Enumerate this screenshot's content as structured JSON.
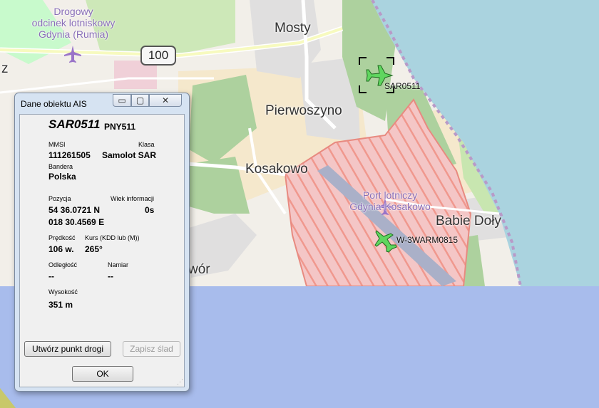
{
  "map": {
    "towns": [
      {
        "id": "mosty",
        "text": "Mosty"
      },
      {
        "id": "pierwoszyno",
        "text": "Pierwoszyno"
      },
      {
        "id": "kosakowo",
        "text": "Kosakowo"
      },
      {
        "id": "babie-doly",
        "text": "Babie Doły"
      },
      {
        "id": "partial-wor",
        "text": "wór"
      },
      {
        "id": "partial-z",
        "text": "z"
      }
    ],
    "airport_labels": [
      {
        "id": "drogowy",
        "lines": [
          "Drogowy",
          "odcinek lotniskowy",
          "Gdynia (Rumia)"
        ]
      },
      {
        "id": "kosakowo-airport",
        "lines": [
          "Port lotniczy",
          "Gdynia-Kosakowo"
        ]
      }
    ],
    "road_number": "100",
    "aircraft": [
      {
        "id": "sar0511",
        "label": "SAR0511",
        "selected": true
      },
      {
        "id": "w3warm0815",
        "label": "W-3WARM0815",
        "selected": false
      }
    ],
    "colors": {
      "sea": "#aad3df",
      "forest": "#add19e",
      "residential": "#e0dfdf",
      "airport_area": "#f4c6c6",
      "aircraft": "#5fd65f",
      "lower_area": "#a8bcec"
    }
  },
  "dialog": {
    "title": "Dane obiektu AIS",
    "controls": {
      "min": "▭",
      "max": "▢",
      "close": "✕"
    },
    "vessel_name": "SAR0511",
    "callsign": "PNY511",
    "fields": {
      "mmsi": {
        "label": "MMSI",
        "value": "111261505"
      },
      "klasa": {
        "label": "Klasa",
        "value": "Samolot SAR"
      },
      "bandera": {
        "label": "Bandera",
        "value": "Polska"
      },
      "pozycja": {
        "label": "Pozycja",
        "lat": "54 36.0721 N",
        "lon": "018 30.4569 E"
      },
      "wiek": {
        "label": "Wiek informacji",
        "value": "0s"
      },
      "predkosc": {
        "label": "Prędkość",
        "value": "106 w."
      },
      "kurs": {
        "label": "Kurs (KDD lub (M))",
        "value": "265°"
      },
      "odleglosc": {
        "label": "Odległość",
        "value": "--"
      },
      "namiar": {
        "label": "Namiar",
        "value": "--"
      },
      "wysokosc": {
        "label": "Wysokość",
        "value": "351 m"
      }
    },
    "buttons": {
      "waypoint": "Utwórz punkt drogi",
      "save_track": "Zapisz ślad",
      "ok": "OK"
    }
  }
}
